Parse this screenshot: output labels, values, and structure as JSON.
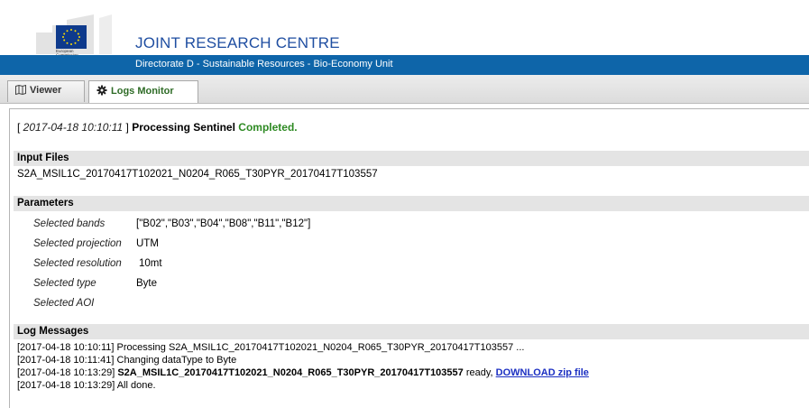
{
  "header": {
    "logo_text_1": "European",
    "logo_text_2": "Commission",
    "title": "JOINT RESEARCH CENTRE",
    "subtitle": "Directorate D - Sustainable Resources - Bio-Economy Unit"
  },
  "tabs": [
    {
      "label": "Viewer",
      "icon": "map-icon",
      "active": false
    },
    {
      "label": "Logs Monitor",
      "icon": "gear-icon",
      "active": true
    }
  ],
  "status": {
    "timestamp": "2017-04-18 10:10:11",
    "process": "Processing Sentinel",
    "state": "Completed."
  },
  "input_files": {
    "heading": "Input Files",
    "file": "S2A_MSIL1C_20170417T102021_N0204_R065_T30PYR_20170417T103557"
  },
  "parameters": {
    "heading": "Parameters",
    "rows": [
      {
        "label": "Selected bands",
        "value": "[\"B02\",\"B03\",\"B04\",\"B08\",\"B11\",\"B12\"]"
      },
      {
        "label": "Selected projection",
        "value": "UTM"
      },
      {
        "label": "Selected resolution",
        "value": "10mt"
      },
      {
        "label": "Selected type",
        "value": "Byte"
      },
      {
        "label": "Selected AOI",
        "value": ""
      }
    ]
  },
  "log_messages": {
    "heading": "Log Messages",
    "line1": "[2017-04-18 10:10:11] Processing S2A_MSIL1C_20170417T102021_N0204_R065_T30PYR_20170417T103557 ...",
    "line2": "[2017-04-18 10:11:41] Changing dataType to Byte",
    "line3_prefix": "[2017-04-18 10:13:29] ",
    "line3_file": "S2A_MSIL1C_20170417T102021_N0204_R065_T30PYR_20170417T103557",
    "line3_mid": " ready, ",
    "line3_link": "DOWNLOAD zip file",
    "line4": "[2017-04-18 10:13:29] All done."
  }
}
